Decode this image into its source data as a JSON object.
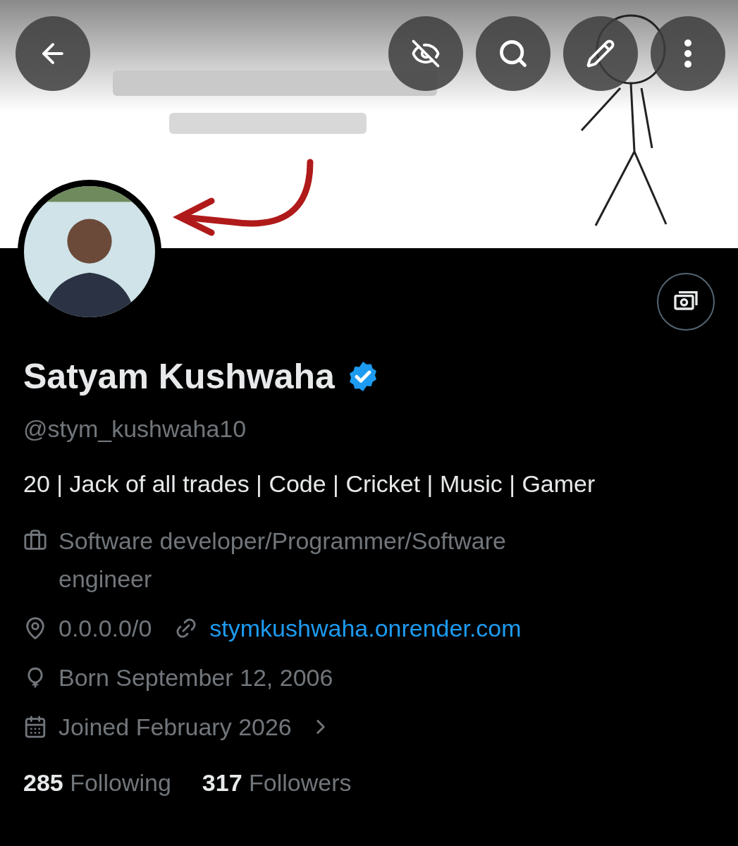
{
  "profile": {
    "name": "Satyam Kushwaha",
    "verified": true,
    "handle": "@stym_kushwaha10",
    "bio": "20 | Jack of all trades | Code | Cricket | Music | Gamer"
  },
  "details": [
    {
      "kind": "job",
      "text": "Software developer/Programmer/Software engineer"
    },
    {
      "kind": "location",
      "text": "0.0.0.0/0"
    },
    {
      "kind": "link",
      "text": "stymkushwaha.onrender.com"
    },
    {
      "kind": "birthday",
      "text": "Born September 12, 2006"
    },
    {
      "kind": "joined",
      "text": "Joined February 2026"
    }
  ],
  "stats": [
    {
      "count": "285",
      "label": "Following"
    },
    {
      "count": "317",
      "label": "Followers"
    }
  ]
}
